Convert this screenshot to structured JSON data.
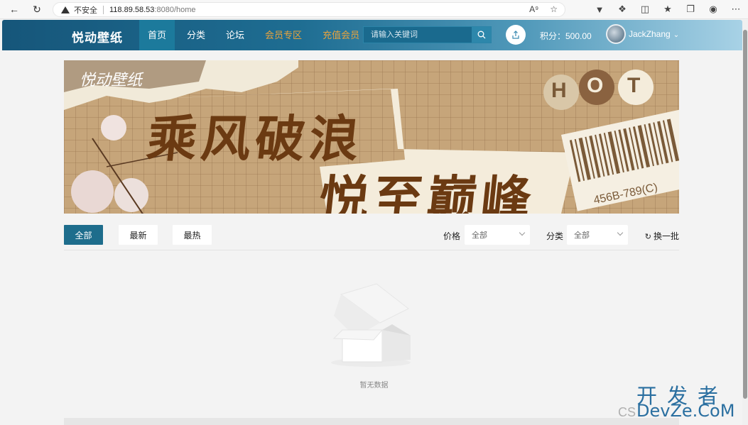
{
  "browser": {
    "security_label": "不安全",
    "url_host": "118.89.58.53",
    "url_path": ":8080/home"
  },
  "header": {
    "logo": "悦动壁纸",
    "nav": [
      {
        "label": "首页",
        "active": true
      },
      {
        "label": "分类",
        "active": false
      },
      {
        "label": "论坛",
        "active": false
      },
      {
        "label": "会员专区",
        "active": false
      },
      {
        "label": "充值会员",
        "active": false
      }
    ],
    "search_placeholder": "请输入关键词",
    "points_label": "积分：500.00",
    "username": "JackZhang"
  },
  "banner": {
    "brand": "悦动壁纸",
    "line1": "乘风破浪",
    "line2": "悦至巅峰",
    "badge_h": "H",
    "badge_o": "O",
    "badge_t": "T",
    "barcode_text": "456B-789(C)"
  },
  "filters": {
    "tabs": [
      {
        "label": "全部",
        "active": true
      },
      {
        "label": "最新",
        "active": false
      },
      {
        "label": "最热",
        "active": false
      }
    ],
    "price_label": "价格",
    "price_value": "全部",
    "category_label": "分类",
    "category_value": "全部",
    "refresh_label": "换一批"
  },
  "empty": {
    "text": "暂无数据"
  },
  "watermark": {
    "cn": "开发者",
    "en": "DevZe.CoM",
    "cs": "CS"
  },
  "colors": {
    "header_start": "#16567a",
    "active_tab": "#1e6d8c",
    "gold": "#e8a33d",
    "banner_text": "#6b3a12"
  }
}
